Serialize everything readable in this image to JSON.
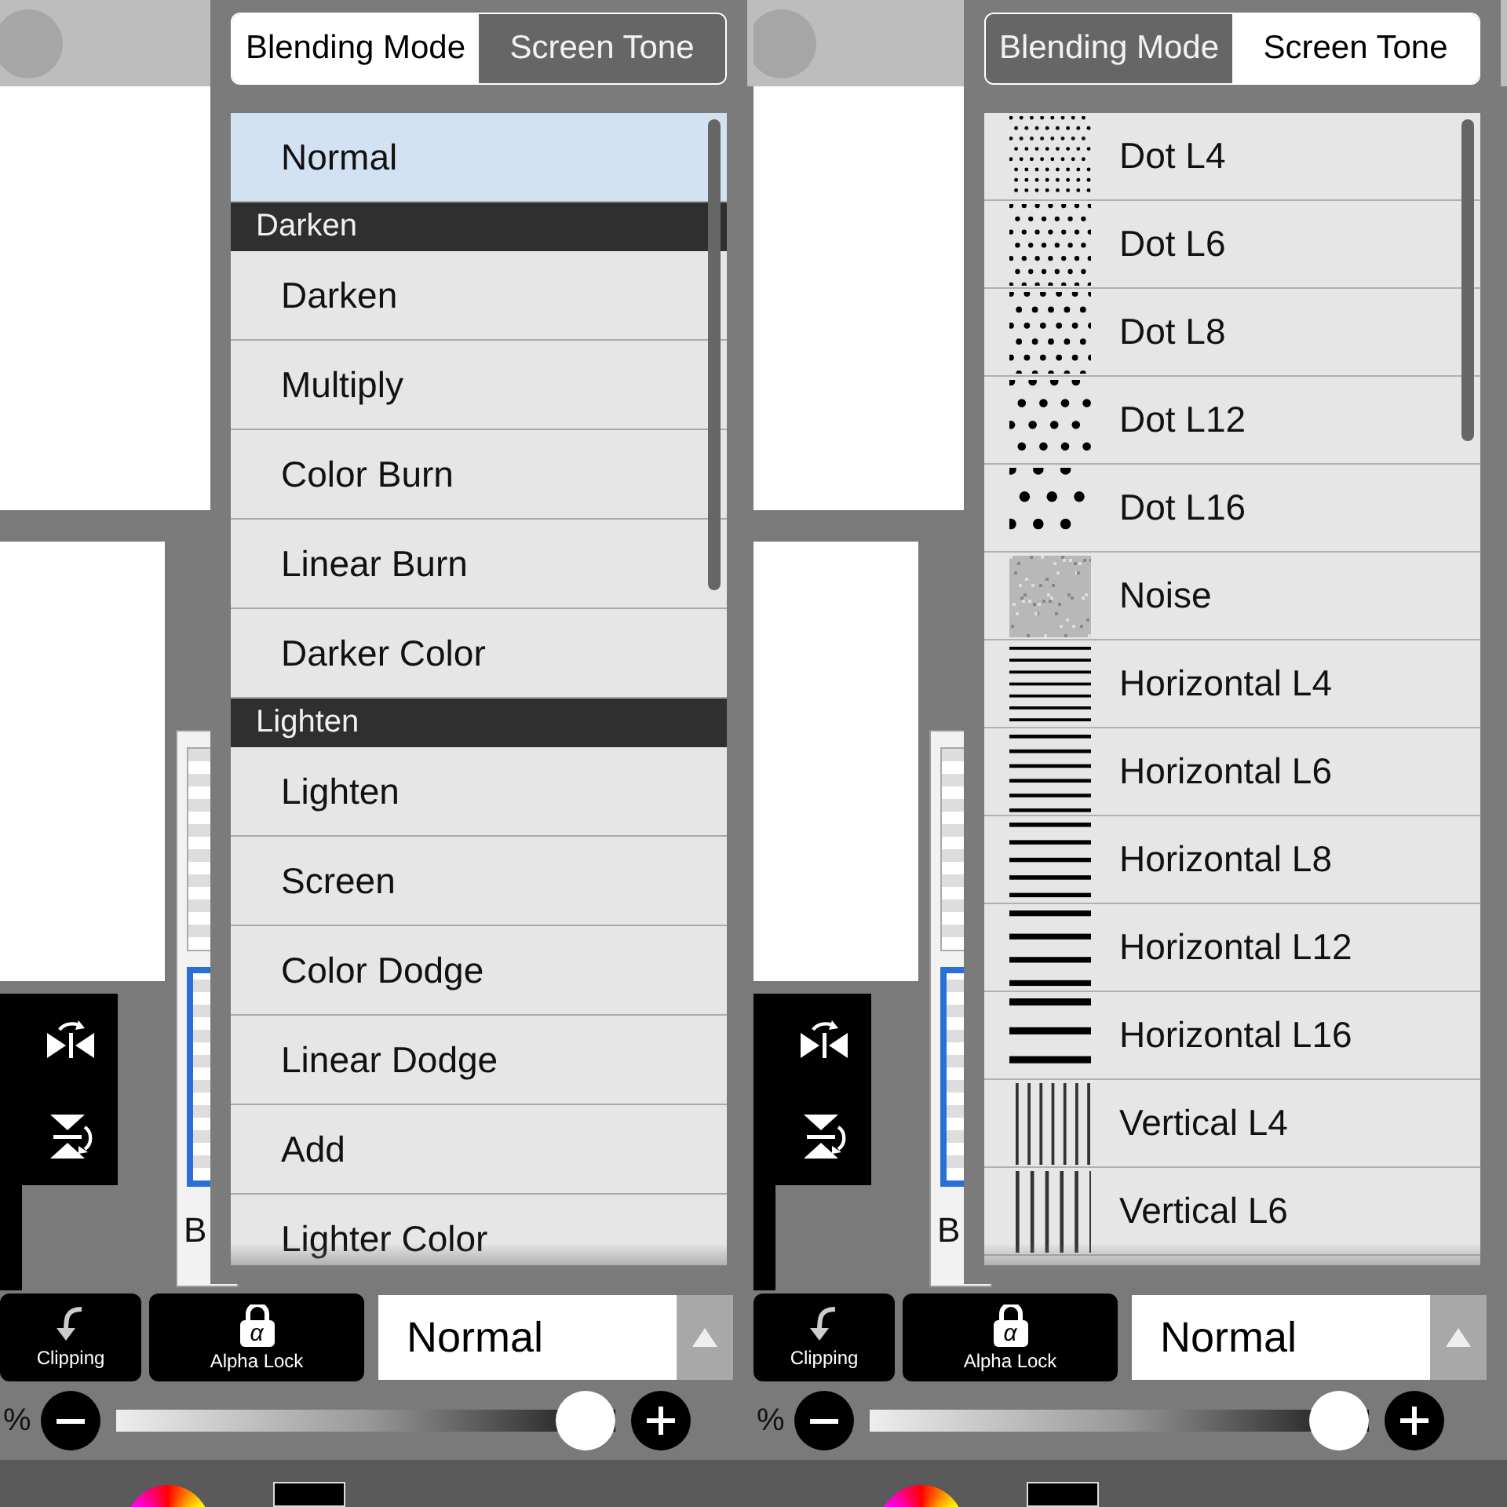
{
  "panels": [
    {
      "tabs": [
        {
          "label": "Blending Mode",
          "selected": true
        },
        {
          "label": "Screen Tone",
          "selected": false
        }
      ],
      "items": [
        {
          "kind": "option",
          "label": "Normal",
          "selected": true
        },
        {
          "kind": "header",
          "label": "Darken"
        },
        {
          "kind": "option",
          "label": "Darken",
          "selected": false
        },
        {
          "kind": "option",
          "label": "Multiply",
          "selected": false
        },
        {
          "kind": "option",
          "label": "Color Burn",
          "selected": false
        },
        {
          "kind": "option",
          "label": "Linear Burn",
          "selected": false
        },
        {
          "kind": "option",
          "label": "Darker Color",
          "selected": false
        },
        {
          "kind": "header",
          "label": "Lighten"
        },
        {
          "kind": "option",
          "label": "Lighten",
          "selected": false
        },
        {
          "kind": "option",
          "label": "Screen",
          "selected": false
        },
        {
          "kind": "option",
          "label": "Color Dodge",
          "selected": false
        },
        {
          "kind": "option",
          "label": "Linear Dodge",
          "selected": false
        },
        {
          "kind": "option",
          "label": "Add",
          "selected": false
        },
        {
          "kind": "option",
          "label": "Lighter Color",
          "selected": false
        }
      ],
      "layer_name": "B",
      "clipping": "Clipping",
      "alpha_lock": "Alpha Lock",
      "lock_glyph": "α",
      "blend_value": "Normal",
      "opacity_unit": "%",
      "opacity": {
        "level": 0.94
      }
    },
    {
      "tabs": [
        {
          "label": "Blending Mode",
          "selected": false
        },
        {
          "label": "Screen Tone",
          "selected": true
        }
      ],
      "items": [
        {
          "kind": "dot",
          "label": "Dot L4"
        },
        {
          "kind": "dot",
          "label": "Dot L6"
        },
        {
          "kind": "dot",
          "label": "Dot L8"
        },
        {
          "kind": "dot",
          "label": "Dot L12"
        },
        {
          "kind": "dot",
          "label": "Dot L16"
        },
        {
          "kind": "noise",
          "label": "Noise"
        },
        {
          "kind": "horizontal",
          "label": "Horizontal L4"
        },
        {
          "kind": "horizontal",
          "label": "Horizontal L6"
        },
        {
          "kind": "horizontal",
          "label": "Horizontal L8"
        },
        {
          "kind": "horizontal",
          "label": "Horizontal L12"
        },
        {
          "kind": "horizontal",
          "label": "Horizontal L16"
        },
        {
          "kind": "vertical",
          "label": "Vertical L4"
        },
        {
          "kind": "vertical",
          "label": "Vertical L6"
        }
      ],
      "layer_name": "B",
      "clipping": "Clipping",
      "alpha_lock": "Alpha Lock",
      "lock_glyph": "α",
      "blend_value": "Normal",
      "opacity_unit": "%",
      "opacity": {
        "level": 0.94
      }
    }
  ]
}
